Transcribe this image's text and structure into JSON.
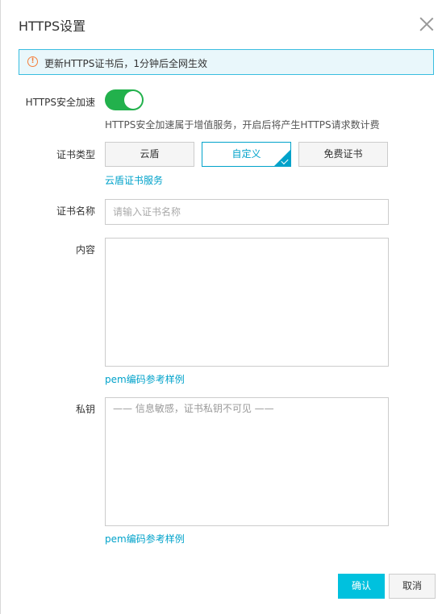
{
  "dialog": {
    "title": "HTTPS设置"
  },
  "notice": {
    "text": "更新HTTPS证书后，1分钟后全网生效",
    "icon": "warning-icon"
  },
  "https_accel": {
    "label": "HTTPS安全加速",
    "enabled": true,
    "hint": "HTTPS安全加速属于增值服务，开启后将产生HTTPS请求数计费"
  },
  "cert_type": {
    "label": "证书类型",
    "options": [
      "云盾",
      "自定义",
      "免费证书"
    ],
    "selected": "自定义",
    "service_link": "云盾证书服务"
  },
  "cert_name": {
    "label": "证书名称",
    "placeholder": "请输入证书名称",
    "value": ""
  },
  "content": {
    "label": "内容",
    "value": "",
    "example_link": "pem编码参考样例"
  },
  "private_key": {
    "label": "私钥",
    "placeholder": "—— 信息敏感，证书私钥不可见 ——",
    "example_link": "pem编码参考样例"
  },
  "footer": {
    "confirm_label": "确认",
    "cancel_label": "取消"
  },
  "colors": {
    "accent": "#00c1de",
    "toggle_on": "#22b14c",
    "notice_border": "#39bde0",
    "warning": "#f47e3b"
  }
}
